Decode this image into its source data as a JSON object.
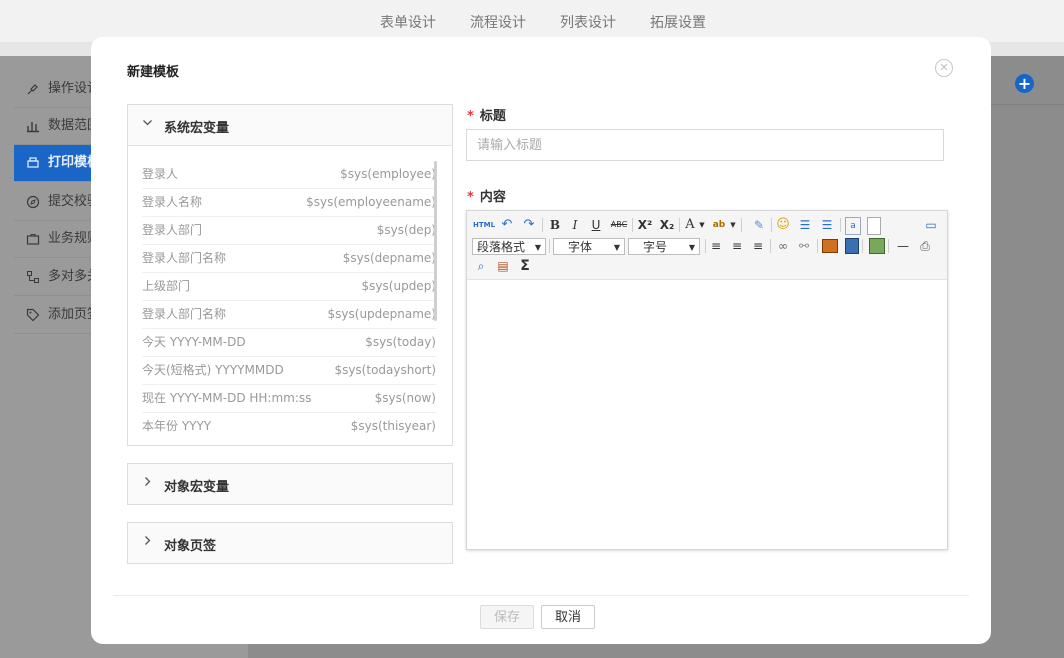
{
  "background": {
    "tabs": [
      "表单设计",
      "流程设计",
      "列表设计",
      "拓展设置"
    ],
    "sidebar": [
      "操作设计",
      "数据范围",
      "打印模板",
      "提交校验",
      "业务规则",
      "多对多关",
      "添加页签"
    ],
    "active_sidebar_index": 2,
    "accent_color": "#1a66c7"
  },
  "modal": {
    "title": "新建模板",
    "close_icon": "close-circle-icon",
    "system_vars": {
      "title": "系统宏变量",
      "items": [
        {
          "label": "登录人",
          "value": "$sys(employee)"
        },
        {
          "label": "登录人名称",
          "value": "$sys(employeename)"
        },
        {
          "label": "登录人部门",
          "value": "$sys(dep)"
        },
        {
          "label": "登录人部门名称",
          "value": "$sys(depname)"
        },
        {
          "label": "上级部门",
          "value": "$sys(updep)"
        },
        {
          "label": "登录人部门名称",
          "value": "$sys(updepname)"
        },
        {
          "label": "今天 YYYY-MM-DD",
          "value": "$sys(today)"
        },
        {
          "label": "今天(短格式) YYYYMMDD",
          "value": "$sys(todayshort)"
        },
        {
          "label": "现在 YYYY-MM-DD HH:mm:ss",
          "value": "$sys(now)"
        },
        {
          "label": "本年份 YYYY",
          "value": "$sys(thisyear)"
        }
      ]
    },
    "object_vars": {
      "title": "对象宏变量"
    },
    "object_tabs": {
      "title": "对象页签"
    },
    "form": {
      "title_label": "标题",
      "title_placeholder": "请输入标题",
      "content_label": "内容",
      "required_mark": "*"
    },
    "editor": {
      "html_label": "HTML",
      "bold": "B",
      "italic": "I",
      "underline": "U",
      "strike": "ABC",
      "superscript": "X²",
      "subscript": "X₂",
      "font_color": "A",
      "sigma": "Σ",
      "paragraph_format": "段落格式",
      "font_family": "字体",
      "font_size": "字号"
    },
    "footer": {
      "save": "保存",
      "cancel": "取消"
    }
  }
}
